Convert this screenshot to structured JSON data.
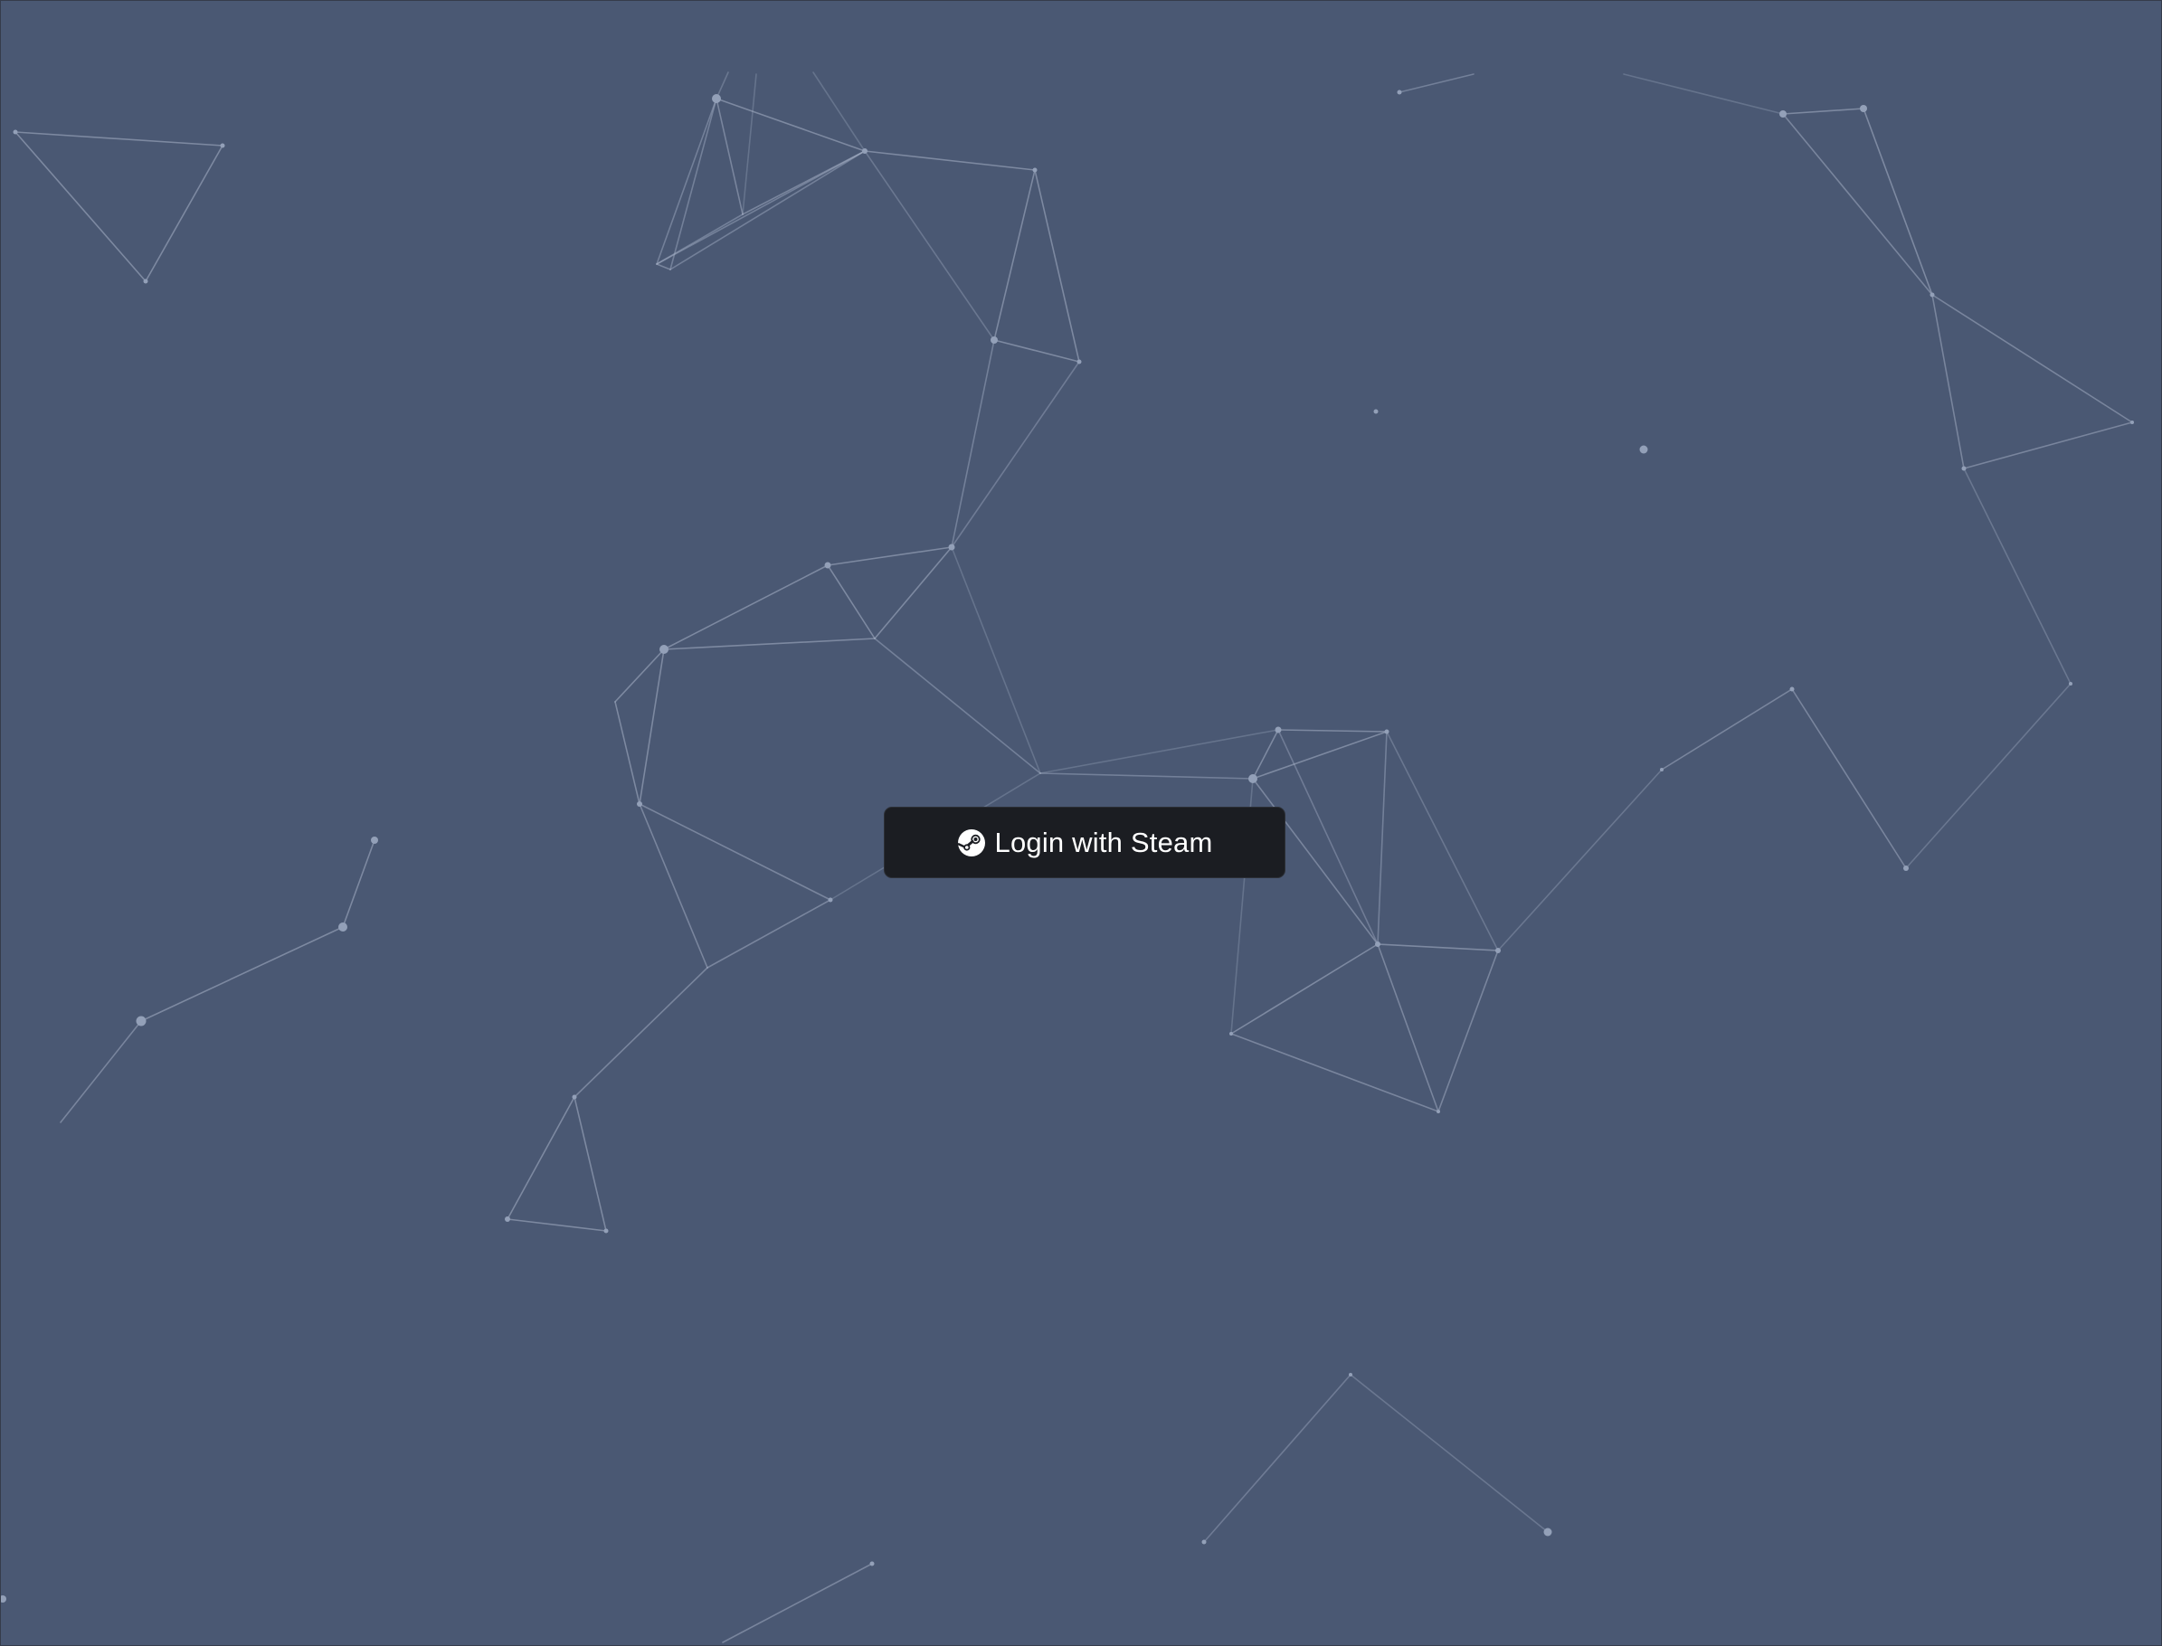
{
  "login": {
    "button_label": "Login with Steam",
    "icon": "steam-icon"
  },
  "theme": {
    "background": "#4a5873",
    "button_background": "#1b1d22",
    "button_text": "#ffffff",
    "particle_color": "#a7b2c7"
  }
}
